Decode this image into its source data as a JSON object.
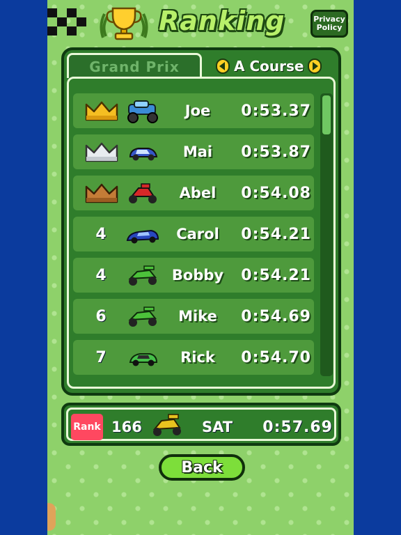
{
  "header": {
    "title": "Ranking",
    "privacy_label": "Privacy Policy"
  },
  "tabs": {
    "grand_prix": "Grand Prix",
    "course": "A Course"
  },
  "colors": {
    "gold": "#f0b81f",
    "silver": "#d9dde2",
    "bronze": "#b87333",
    "rank_badge": "#ff4860"
  },
  "rankings": [
    {
      "rank": "1",
      "icon": "gold-crown-icon",
      "car": "monster-truck-car-icon",
      "name": "Joe",
      "time": "0:53.37"
    },
    {
      "rank": "2",
      "icon": "silver-crown-icon",
      "car": "blue-sedan-car-icon",
      "name": "Mai",
      "time": "0:53.87"
    },
    {
      "rank": "3",
      "icon": "bronze-crown-icon",
      "car": "red-buggy-car-icon",
      "name": "Abel",
      "time": "0:54.08"
    },
    {
      "rank": "4",
      "icon": "",
      "car": "blue-sports-car-icon",
      "name": "Carol",
      "time": "0:54.21"
    },
    {
      "rank": "4",
      "icon": "",
      "car": "green-buggy-car-icon",
      "name": "Bobby",
      "time": "0:54.21"
    },
    {
      "rank": "6",
      "icon": "",
      "car": "green-buggy-car-icon",
      "name": "Mike",
      "time": "0:54.69"
    },
    {
      "rank": "7",
      "icon": "",
      "car": "green-coupe-car-icon",
      "name": "Rick",
      "time": "0:54.70"
    }
  ],
  "my_rank": {
    "badge": "Rank",
    "position": "166",
    "car": "yellow-buggy-car-icon",
    "name": "SAT",
    "time": "0:57.69"
  },
  "back_label": "Back"
}
